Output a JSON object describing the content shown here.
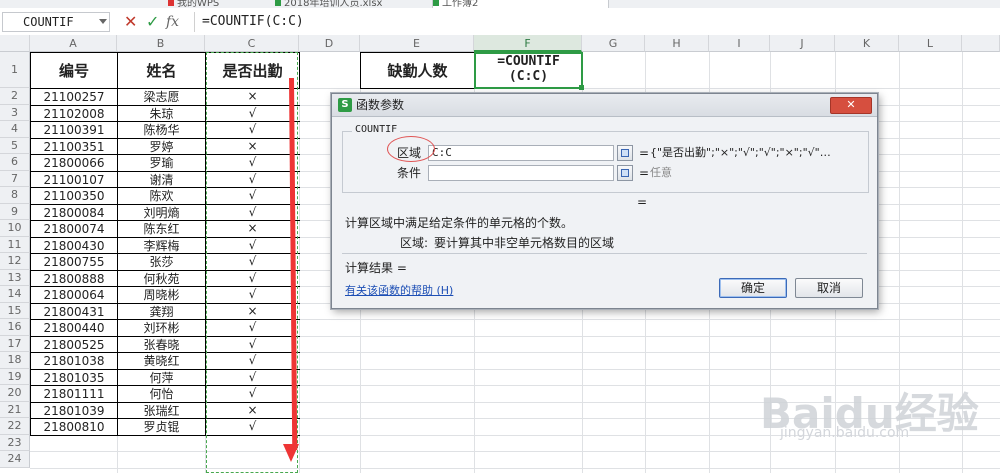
{
  "tabs": [
    {
      "label": "我的WPS",
      "active": false
    },
    {
      "label": "2018年培训人员.xlsx",
      "active": false
    },
    {
      "label": "工作簿2",
      "active": true
    }
  ],
  "formula_bar": {
    "name_box": "COUNTIF",
    "cancel_glyph": "✕",
    "confirm_glyph": "✓",
    "fx_glyph": "fx",
    "formula": "=COUNTIF(C:C)"
  },
  "columns": [
    "A",
    "B",
    "C",
    "D",
    "E",
    "F",
    "G",
    "H",
    "I",
    "J",
    "K",
    "L"
  ],
  "rows": [
    "1",
    "2",
    "3",
    "4",
    "5",
    "6",
    "7",
    "8",
    "9",
    "10",
    "11",
    "12",
    "13",
    "14",
    "15",
    "16",
    "17",
    "18",
    "19",
    "20",
    "21",
    "22",
    "23",
    "24"
  ],
  "table": {
    "headers": [
      "编号",
      "姓名",
      "是否出勤"
    ],
    "rows": [
      [
        "21100257",
        "梁志愿",
        "×"
      ],
      [
        "21102008",
        "朱琼",
        "√"
      ],
      [
        "21100391",
        "陈杨华",
        "√"
      ],
      [
        "21100351",
        "罗婷",
        "×"
      ],
      [
        "21800066",
        "罗瑜",
        "√"
      ],
      [
        "21100107",
        "谢清",
        "√"
      ],
      [
        "21100350",
        "陈欢",
        "√"
      ],
      [
        "21800084",
        "刘明熵",
        "√"
      ],
      [
        "21800074",
        "陈东红",
        "×"
      ],
      [
        "21800430",
        "李辉梅",
        "√"
      ],
      [
        "21800755",
        "张莎",
        "√"
      ],
      [
        "21800888",
        "何秋苑",
        "√"
      ],
      [
        "21800064",
        "周晓彬",
        "√"
      ],
      [
        "21800431",
        "龚翔",
        "×"
      ],
      [
        "21800440",
        "刘环彬",
        "√"
      ],
      [
        "21800525",
        "张春晓",
        "√"
      ],
      [
        "21801038",
        "黄晓红",
        "√"
      ],
      [
        "21801035",
        "何萍",
        "√"
      ],
      [
        "21801111",
        "何怡",
        "√"
      ],
      [
        "21801039",
        "张瑞红",
        "×"
      ],
      [
        "21800810",
        "罗贞锟",
        "√"
      ]
    ]
  },
  "absence": {
    "label": "缺勤人数",
    "formula_line1": "=COUNTIF",
    "formula_line2": "(C:C)"
  },
  "dialog": {
    "title": "函数参数",
    "logo": "S",
    "close_glyph": "✕",
    "function_name": "COUNTIF",
    "args": [
      {
        "label": "区域",
        "value": "C:C",
        "eq": "=",
        "result": "{\"是否出勤\";\"×\";\"√\";\"√\";\"×\";\"√\"…"
      },
      {
        "label": "条件",
        "value": "",
        "eq": "=",
        "result": "任意"
      }
    ],
    "result_eq": "=",
    "description": "计算区域中满足给定条件的单元格的个数。",
    "arg_help_label": "区域:",
    "arg_help_text": "要计算其中非空单元格数目的区域",
    "calc_result": "计算结果 =",
    "help_link": "有关该函数的帮助 (H)",
    "ok": "确定",
    "cancel": "取消"
  },
  "watermark": {
    "main": "Baidu经验",
    "sub": "jingyan.baidu.com"
  }
}
